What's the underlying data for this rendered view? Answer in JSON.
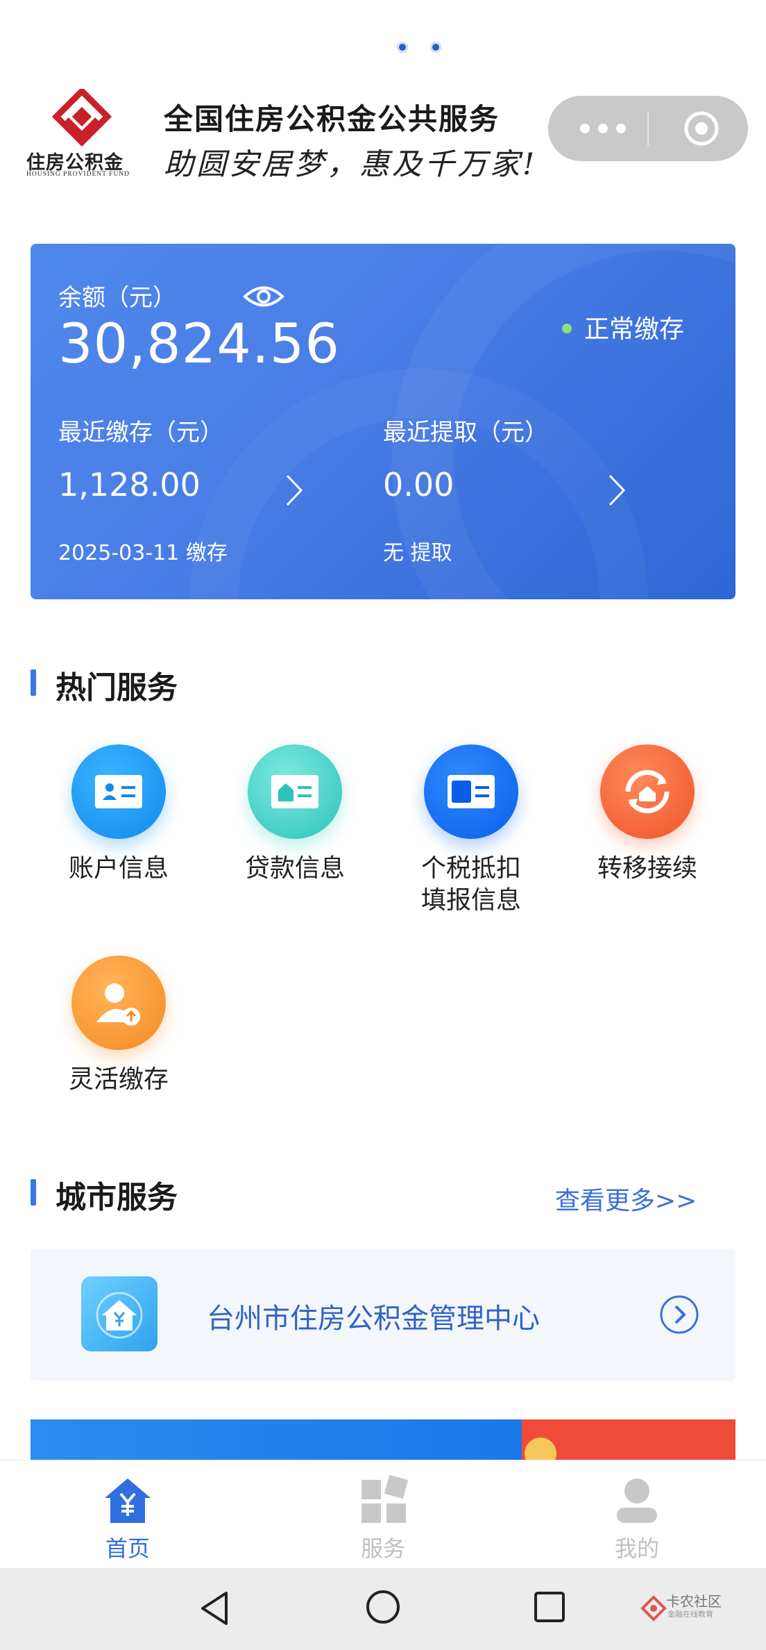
{
  "header": {
    "logo_cn": "住房公积金",
    "logo_en": "HOUSING  PROVIDENT  FUND",
    "title": "全国住房公积金公共服务",
    "slogan": "助圆安居梦，惠及千万家!"
  },
  "balance_card": {
    "balance_label": "余额（元）",
    "balance_value": "30,824.56",
    "status_text": "正常缴存",
    "recent_deposit_label": "最近缴存（元）",
    "recent_deposit_value": "1,128.00",
    "recent_deposit_note": "2025-03-11 缴存",
    "recent_withdraw_label": "最近提取（元）",
    "recent_withdraw_value": "0.00",
    "recent_withdraw_note": "无 提取"
  },
  "hot_services": {
    "title": "热门服务",
    "items": [
      {
        "label_line1": "账户信息",
        "label_line2": "",
        "icon": "id-card-icon",
        "color": "#1e9bf5"
      },
      {
        "label_line1": "贷款信息",
        "label_line2": "",
        "icon": "loan-card-icon",
        "color": "#3fd1c8"
      },
      {
        "label_line1": "个税抵扣",
        "label_line2": "填报信息",
        "icon": "tax-card-icon",
        "color": "#1670f0"
      },
      {
        "label_line1": "转移接续",
        "label_line2": "",
        "icon": "transfer-house-icon",
        "color": "#f56a3c"
      },
      {
        "label_line1": "灵活缴存",
        "label_line2": "",
        "icon": "flexible-user-icon",
        "color": "#f7963a"
      }
    ]
  },
  "city_services": {
    "title": "城市服务",
    "more_link": "查看更多>>",
    "center_name": "台州市住房公积金管理中心"
  },
  "tabbar": {
    "items": [
      {
        "label": "首页",
        "icon": "home-yuan-icon",
        "active": true
      },
      {
        "label": "服务",
        "icon": "services-grid-icon",
        "active": false
      },
      {
        "label": "我的",
        "icon": "profile-icon",
        "active": false
      }
    ]
  },
  "watermark": {
    "title": "卡农社区",
    "subtitle": "金融在线教育"
  },
  "colors": {
    "accent": "#3a6fd9",
    "card_gradient_start": "#4f88ec",
    "card_gradient_end": "#2f66d6",
    "status_dot": "#8ee07a"
  }
}
